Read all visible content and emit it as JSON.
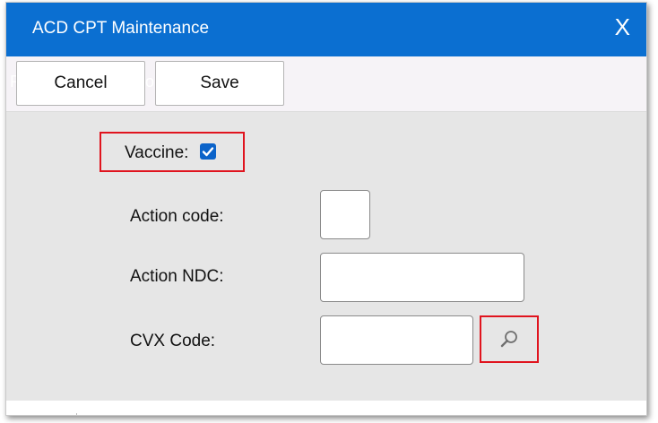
{
  "dialog": {
    "title": "ACD CPT Maintenance",
    "close_label": "X"
  },
  "toolbar": {
    "ghost_left": "Rec",
    "ghost_right": "Options",
    "cancel_label": "Cancel",
    "save_label": "Save"
  },
  "form": {
    "vaccine_label": "Vaccine:",
    "vaccine_checked": true,
    "action_code_label": "Action code:",
    "action_code_value": "",
    "action_ndc_label": "Action NDC:",
    "action_ndc_value": "",
    "cvx_code_label": "CVX Code:",
    "cvx_code_value": ""
  },
  "colors": {
    "titlebar": "#0b6fd1",
    "highlight": "#e0141e",
    "body": "#e6e6e6",
    "checkbox": "#0b63c9"
  },
  "icons": {
    "close": "close-icon",
    "search": "search-icon",
    "check": "checkmark-icon"
  }
}
